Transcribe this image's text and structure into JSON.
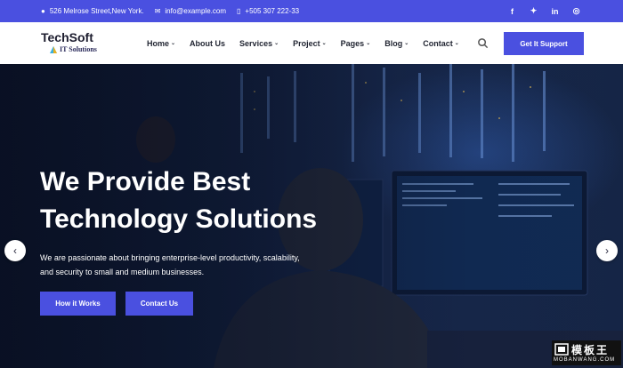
{
  "topbar": {
    "address": "526 Melrose Street,New York.",
    "email": "info@example.com",
    "phone": "+505 307 222-33",
    "social": [
      {
        "icon": "facebook-icon",
        "glyph": "f"
      },
      {
        "icon": "twitter-icon",
        "glyph": "✦"
      },
      {
        "icon": "linkedin-icon",
        "glyph": "in"
      },
      {
        "icon": "instagram-icon",
        "glyph": "◎"
      }
    ]
  },
  "header": {
    "logo_name": "TechSoft",
    "logo_sub": "IT Solutions",
    "nav": [
      {
        "label": "Home",
        "dropdown": true
      },
      {
        "label": "About Us",
        "dropdown": false
      },
      {
        "label": "Services",
        "dropdown": true
      },
      {
        "label": "Project",
        "dropdown": true
      },
      {
        "label": "Pages",
        "dropdown": true
      },
      {
        "label": "Blog",
        "dropdown": true
      },
      {
        "label": "Contact",
        "dropdown": true
      }
    ],
    "cta": "Get It Support"
  },
  "hero": {
    "title_line1": "We Provide Best",
    "title_line2": "Technology Solutions",
    "description": "We are passionate about bringing enterprise-level productivity, scalability, and security to small and medium businesses.",
    "button_primary": "How it Works",
    "button_secondary": "Contact Us"
  },
  "watermark": {
    "cn": "模板王",
    "en": "MOBANWANG.COM"
  },
  "colors": {
    "accent": "#4a50e0",
    "dark": "#1f2330"
  }
}
